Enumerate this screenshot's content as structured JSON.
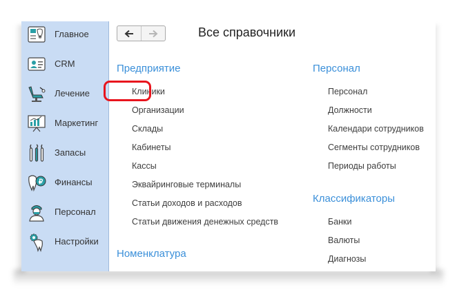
{
  "sidebar": {
    "items": [
      {
        "label": "Главное",
        "icon": "home-tooth-icon"
      },
      {
        "label": "CRM",
        "icon": "id-card-icon"
      },
      {
        "label": "Лечение",
        "icon": "dental-chair-icon"
      },
      {
        "label": "Маркетинг",
        "icon": "presentation-board-icon"
      },
      {
        "label": "Запасы",
        "icon": "dental-tools-icon"
      },
      {
        "label": "Финансы",
        "icon": "tooth-coin-icon"
      },
      {
        "label": "Персонал",
        "icon": "doctor-icon"
      },
      {
        "label": "Настройки",
        "icon": "tooth-gear-icon"
      }
    ]
  },
  "toolbar": {
    "back_icon": "arrow-left-icon",
    "forward_icon": "arrow-right-icon"
  },
  "page": {
    "title": "Все справочники"
  },
  "sections": {
    "enterprise": {
      "title": "Предприятие",
      "items": [
        "Клиники",
        "Организации",
        "Склады",
        "Кабинеты",
        "Кассы",
        "Эквайринговые терминалы",
        "Статьи доходов и расходов",
        "Статьи движения денежных средств"
      ]
    },
    "nomenclature": {
      "title": "Номенклатура"
    },
    "staff": {
      "title": "Персонал",
      "items": [
        "Персонал",
        "Должности",
        "Календари сотрудников",
        "Сегменты сотрудников",
        "Периоды работы"
      ]
    },
    "classifiers": {
      "title": "Классификаторы",
      "items": [
        "Банки",
        "Валюты",
        "Диагнозы"
      ]
    }
  },
  "colors": {
    "sidebar_bg": "#c9dcf4",
    "section_title": "#3a8fd9",
    "highlight": "#e8141d",
    "icon_teal": "#2a9fa6"
  }
}
